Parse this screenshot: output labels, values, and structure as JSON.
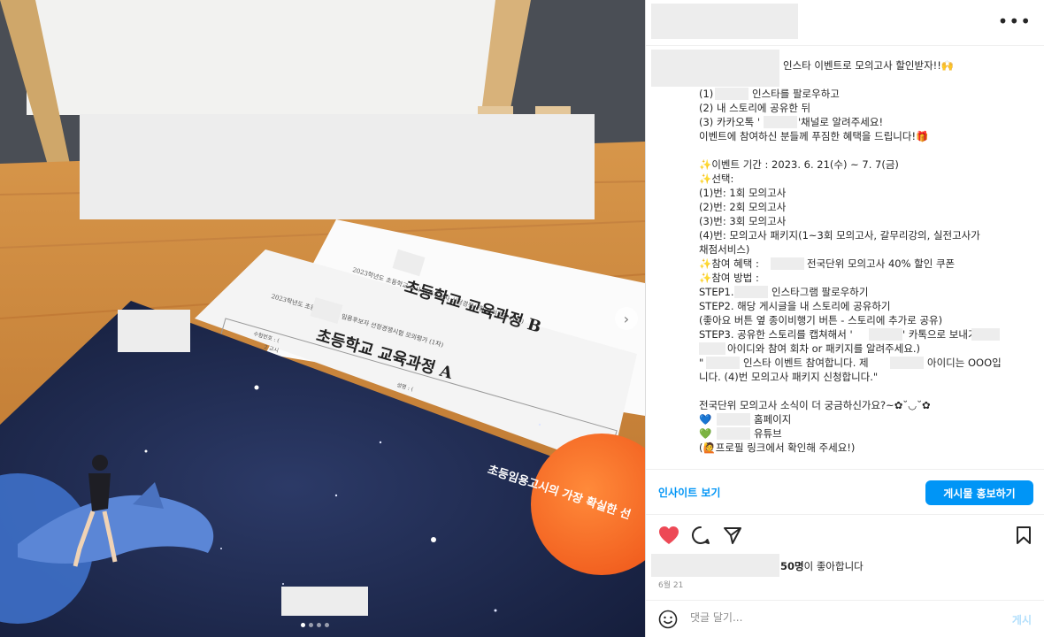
{
  "photo": {
    "doc_b": {
      "header": "2023학년도 초등학교 교사 임용후보자 선정경쟁시험 모의평가 (1차)",
      "title": "초등학교 교육과정 B"
    },
    "doc_a": {
      "header": "2023학년도 초등학교 교사 임용후보자 선정경쟁시험 모의평가 (1차)",
      "title": "초등학교 교육과정 A",
      "field_number": "수험번호 : (",
      "field_name": "성명 : (",
      "field_period": "2 교시"
    },
    "cover_slogan": "초등임용고시의 가장 확실한 선",
    "carousel": {
      "count": 4,
      "active": 0
    },
    "next_glyph": "›"
  },
  "post": {
    "more_glyph": "•••",
    "caption": [
      "인스타 이벤트로 모의고사 할인받자!!🙌",
      "(1)",
      "인스타를 팔로우하고",
      "(2) 내 스토리에 공유한 뒤",
      "(3) 카카오톡 '",
      "'채널로 알려주세요!",
      "이벤트에 참여하신 분들께 푸짐한 혜택을 드립니다!🎁",
      "✨이벤트 기간 : 2023. 6. 21(수) ~ 7. 7(금)",
      "✨선택:",
      "(1)번: 1회 모의고사",
      "(2)번: 2회 모의고사",
      "(3)번: 3회 모의고사",
      "(4)번: 모의고사 패키지(1~3회 모의고사, 갈무리강의, 실전고사가",
      "채점서비스)",
      "✨참여 혜택 :",
      "전국단위 모의고사 40% 할인 쿠폰",
      "✨참여 방법 :",
      "STEP1.",
      "인스타그램 팔로우하기",
      "STEP2. 해당 게시글을 내 스토리에 공유하기",
      "(좋아요 버튼 옆 종이비행기 버튼 - 스토리에 추가로 공유)",
      "STEP3. 공유한 스토리를 캡쳐해서 '",
      "' 카톡으로 보내기 (",
      "아이디와 참여 회차 or 패키지를 알려주세요.)",
      "\"",
      "인스타 이벤트 참여합니다. 제",
      "아이디는 OOO입",
      "니다. (4)번 모의고사 패키지 신청합니다.\"",
      "전국단위 모의고사 소식이 더 궁금하신가요?~✿˘◡˘✿",
      "💙",
      "홈페이지",
      "💚",
      "유튜브",
      "(🙋프로필 링크에서 확인해 주세요!)"
    ],
    "insights_label": "인사이트 보기",
    "promote_label": "게시물 홍보하기",
    "icons": {
      "like": "heart-icon",
      "comment": "comment-icon",
      "share": "paper-plane-icon",
      "save": "bookmark-icon",
      "emoji": "emoji-icon"
    },
    "like_color": "#ed4956",
    "likes_count": "50명",
    "likes_suffix": "이 좋아합니다",
    "date": "6월 21",
    "comment_placeholder": "댓글 달기...",
    "post_label": "게시"
  }
}
